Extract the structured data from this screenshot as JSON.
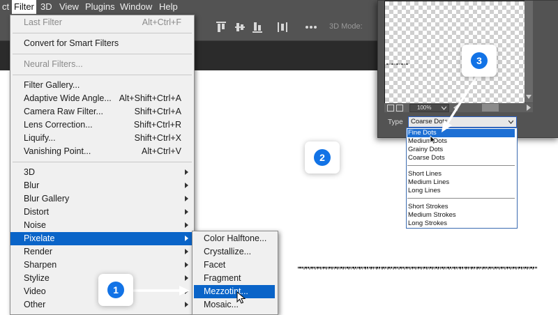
{
  "menubar": {
    "items": [
      {
        "label": "ct"
      },
      {
        "label": "Filter"
      },
      {
        "label": "3D"
      },
      {
        "label": "View"
      },
      {
        "label": "Plugins"
      },
      {
        "label": "Window"
      },
      {
        "label": "Help"
      }
    ]
  },
  "options_bar": {
    "mode_label": "3D Mode:"
  },
  "filter_menu": {
    "last_filter": {
      "label": "Last Filter",
      "shortcut": "Alt+Ctrl+F"
    },
    "convert_smart": {
      "label": "Convert for Smart Filters"
    },
    "neural_filters": {
      "label": "Neural Filters..."
    },
    "filter_gallery": {
      "label": "Filter Gallery..."
    },
    "adaptive_wide": {
      "label": "Adaptive Wide Angle...",
      "shortcut": "Alt+Shift+Ctrl+A"
    },
    "camera_raw": {
      "label": "Camera Raw Filter...",
      "shortcut": "Shift+Ctrl+A"
    },
    "lens_correction": {
      "label": "Lens Correction...",
      "shortcut": "Shift+Ctrl+R"
    },
    "liquify": {
      "label": "Liquify...",
      "shortcut": "Shift+Ctrl+X"
    },
    "vanishing_point": {
      "label": "Vanishing Point...",
      "shortcut": "Alt+Ctrl+V"
    },
    "submenus": [
      {
        "label": "3D"
      },
      {
        "label": "Blur"
      },
      {
        "label": "Blur Gallery"
      },
      {
        "label": "Distort"
      },
      {
        "label": "Noise"
      },
      {
        "label": "Pixelate"
      },
      {
        "label": "Render"
      },
      {
        "label": "Sharpen"
      },
      {
        "label": "Stylize"
      },
      {
        "label": "Video"
      },
      {
        "label": "Other"
      }
    ]
  },
  "pixelate_submenu": {
    "items": [
      {
        "label": "Color Halftone..."
      },
      {
        "label": "Crystallize..."
      },
      {
        "label": "Facet"
      },
      {
        "label": "Fragment"
      },
      {
        "label": "Mezzotint..."
      },
      {
        "label": "Mosaic..."
      }
    ]
  },
  "dialog": {
    "zoom": "100%",
    "type_label": "Type",
    "type_value": "Coarse Dots",
    "options": [
      {
        "label": "Fine Dots"
      },
      {
        "label": "Medium Dots"
      },
      {
        "label": "Grainy Dots"
      },
      {
        "label": "Coarse Dots"
      },
      {
        "label": "Short Lines"
      },
      {
        "label": "Medium Lines"
      },
      {
        "label": "Long Lines"
      },
      {
        "label": "Short Strokes"
      },
      {
        "label": "Medium Strokes"
      },
      {
        "label": "Long Strokes"
      }
    ]
  },
  "callouts": [
    {
      "number": "1"
    },
    {
      "number": "2"
    },
    {
      "number": "3"
    }
  ],
  "colors": {
    "highlight": "#0a64c8",
    "badge": "#1273e6",
    "menubar": "#535353",
    "menu_bg": "#f0f0f0"
  }
}
